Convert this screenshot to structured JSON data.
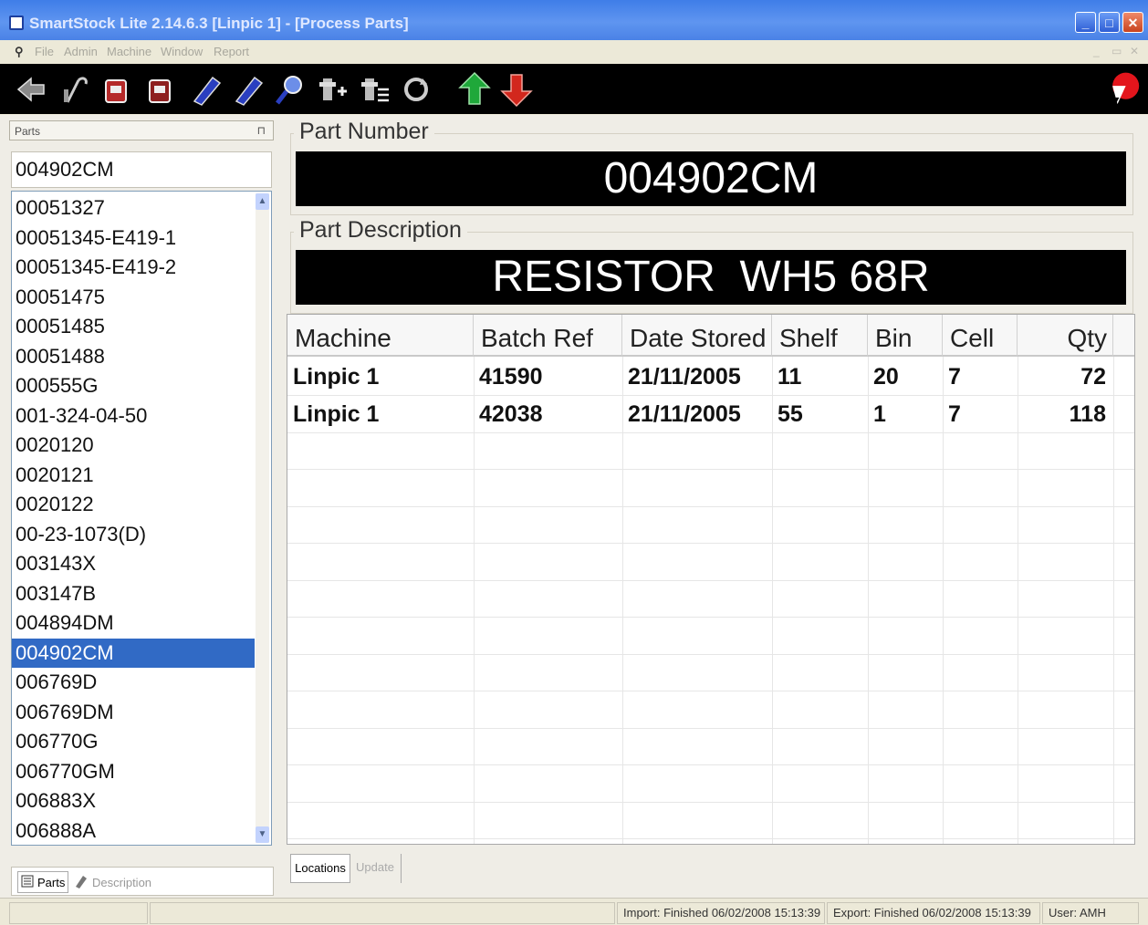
{
  "window": {
    "title": "SmartStock Lite 2.14.6.3 [Linpic 1] - [Process Parts]"
  },
  "menu": {
    "items": [
      "File",
      "Admin",
      "Machine",
      "Window",
      "Report"
    ]
  },
  "parts_panel": {
    "header": "Parts",
    "search_value": "004902CM",
    "items": [
      "00051327",
      "00051345-E419-1",
      "00051345-E419-2",
      "00051475",
      "00051485",
      "00051488",
      "000555G",
      "001-324-04-50",
      "0020120",
      "0020121",
      "0020122",
      "00-23-1073(D)",
      "003143X",
      "003147B",
      "004894DM",
      "004902CM",
      "006769D",
      "006769DM",
      "006770G",
      "006770GM",
      "006883X",
      "006888A"
    ],
    "selected_index": 15,
    "tabs": {
      "parts": "Parts",
      "description": "Description"
    }
  },
  "part_number": {
    "label": "Part Number",
    "value": "004902CM"
  },
  "part_description": {
    "label": "Part Description",
    "value": "RESISTOR  WH5 68R"
  },
  "grid": {
    "columns": [
      "Machine",
      "Batch Ref",
      "Date Stored",
      "Shelf",
      "Bin",
      "Cell",
      "Qty"
    ],
    "rows": [
      {
        "machine": "Linpic 1",
        "batch_ref": "41590",
        "date_stored": "21/11/2005",
        "shelf": "11",
        "bin": "20",
        "cell": "7",
        "qty": "72"
      },
      {
        "machine": "Linpic 1",
        "batch_ref": "42038",
        "date_stored": "21/11/2005",
        "shelf": "55",
        "bin": "1",
        "cell": "7",
        "qty": "118"
      }
    ]
  },
  "bottom_tabs": {
    "locations": "Locations",
    "update": "Update"
  },
  "status": {
    "import": "Import: Finished 06/02/2008 15:13:39",
    "export": "Export: Finished 06/02/2008 15:13:39",
    "user": "User: AMH"
  },
  "colors": {
    "selection": "#316ac5",
    "display_bg": "#000000",
    "titlebar": "#3f7de8"
  }
}
